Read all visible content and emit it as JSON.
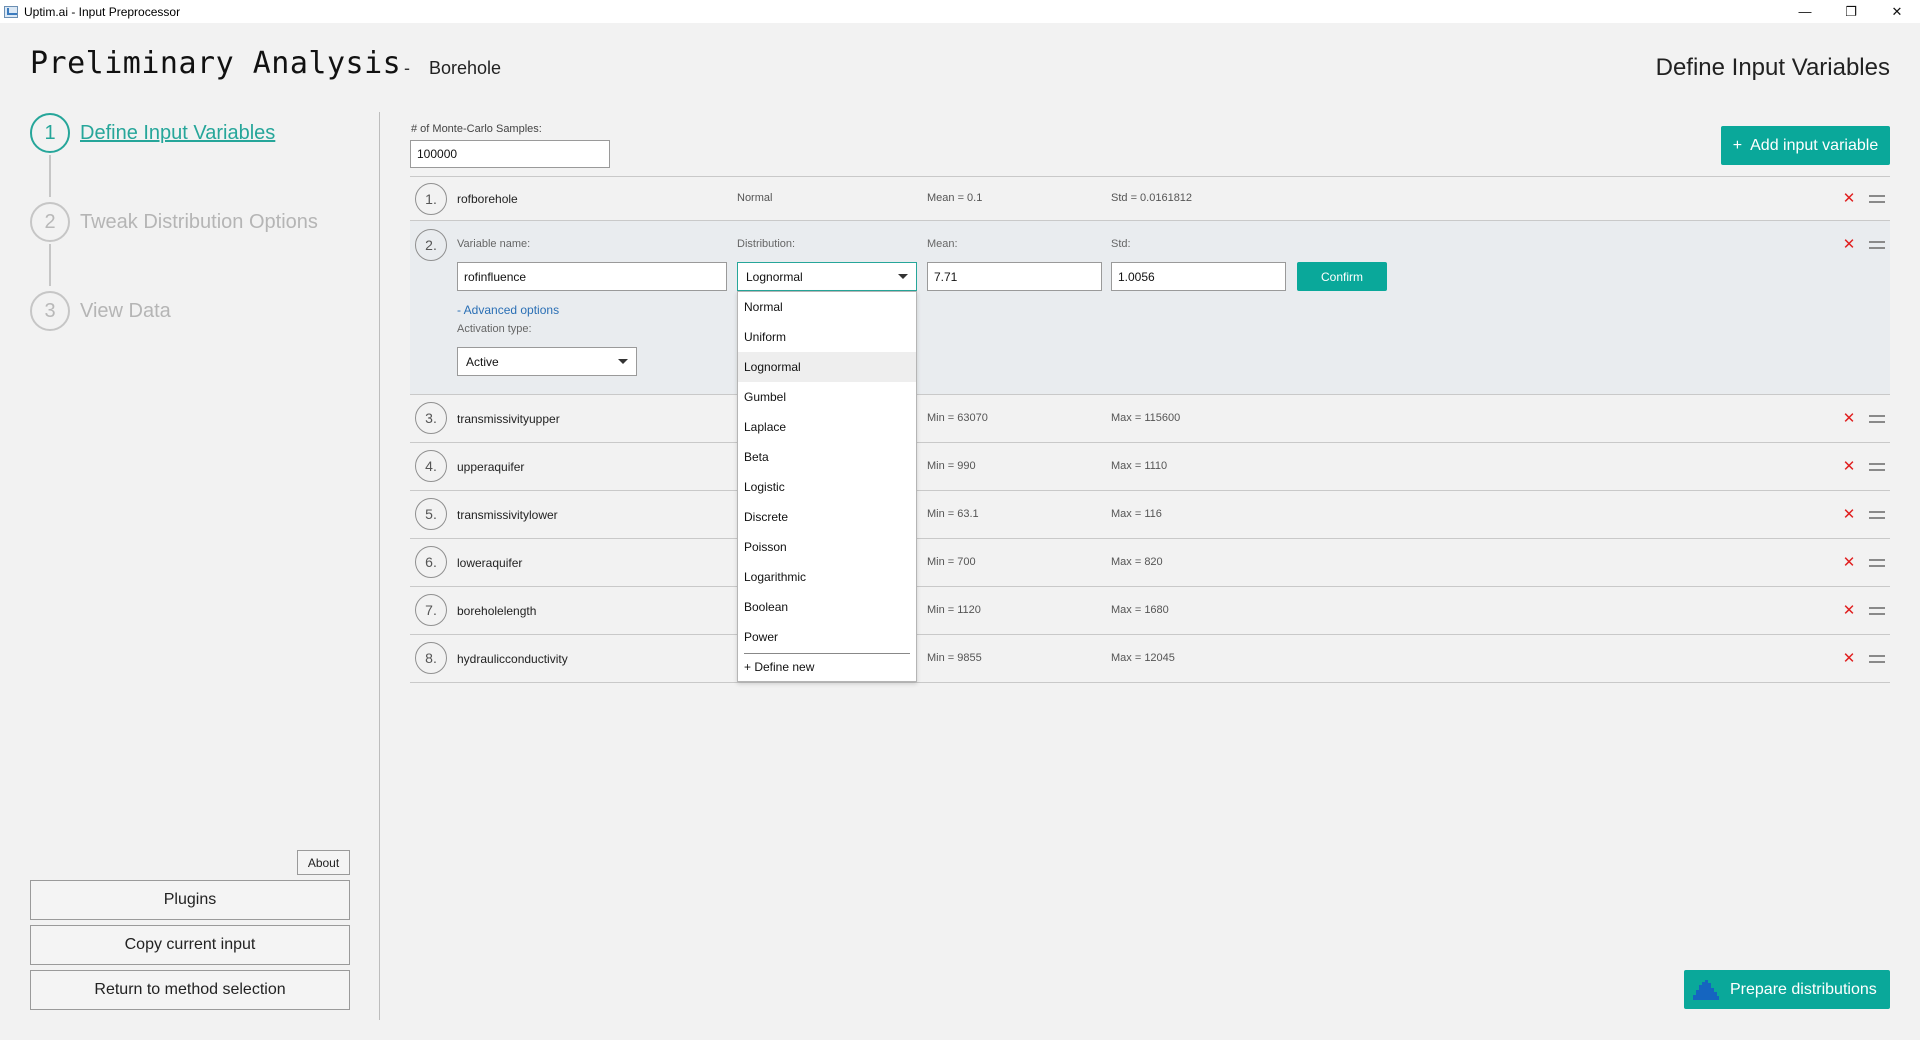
{
  "window": {
    "title": "Uptim.ai - Input Preprocessor",
    "minimize": "—",
    "restore": "❐",
    "close": "✕"
  },
  "header": {
    "title": "Preliminary Analysis",
    "separator": "-",
    "subtitle": "Borehole",
    "right_title": "Define Input Variables"
  },
  "steps": [
    {
      "number": "1",
      "label": "Define Input Variables",
      "active": true
    },
    {
      "number": "2",
      "label": "Tweak Distribution Options",
      "active": false
    },
    {
      "number": "3",
      "label": "View Data",
      "active": false
    }
  ],
  "left_buttons": {
    "about": "About",
    "plugins": "Plugins",
    "copy": "Copy current input",
    "return": "Return to method selection"
  },
  "monte_carlo": {
    "label": "# of Monte-Carlo Samples:",
    "value": "100000"
  },
  "add_button": {
    "icon": "+",
    "label": "Add input variable"
  },
  "rows": [
    {
      "num": "1.",
      "name": "rofborehole",
      "dist": "Normal",
      "p1": "Mean = 0.1",
      "p2": "Std = 0.0161812"
    },
    {
      "num": "3.",
      "name": "transmissivityupper",
      "dist": "",
      "p1": "Min = 63070",
      "p2": "Max = 115600"
    },
    {
      "num": "4.",
      "name": "upperaquifer",
      "dist": "",
      "p1": "Min = 990",
      "p2": "Max = 1110"
    },
    {
      "num": "5.",
      "name": "transmissivitylower",
      "dist": "",
      "p1": "Min = 63.1",
      "p2": "Max = 116"
    },
    {
      "num": "6.",
      "name": "loweraquifer",
      "dist": "",
      "p1": "Min = 700",
      "p2": "Max = 820"
    },
    {
      "num": "7.",
      "name": "boreholelength",
      "dist": "",
      "p1": "Min = 1120",
      "p2": "Max = 1680"
    },
    {
      "num": "8.",
      "name": "hydraulicconductivity",
      "dist": "",
      "p1": "Min = 9855",
      "p2": "Max = 12045"
    }
  ],
  "editor": {
    "num": "2.",
    "name_label": "Variable name:",
    "name_value": "rofinfluence",
    "dist_label": "Distribution:",
    "dist_value": "Lognormal",
    "mean_label": "Mean:",
    "mean_value": "7.71",
    "std_label": "Std:",
    "std_value": "1.0056",
    "confirm": "Confirm",
    "advanced": "- Advanced options",
    "activation_label": "Activation type:",
    "activation_value": "Active"
  },
  "dropdown": {
    "options": [
      "Normal",
      "Uniform",
      "Lognormal",
      "Gumbel",
      "Laplace",
      "Beta",
      "Logistic",
      "Discrete",
      "Poisson",
      "Logarithmic",
      "Boolean",
      "Power"
    ],
    "selected": "Lognormal",
    "define_new": "+ Define new"
  },
  "prepare_button": {
    "label": "Prepare distributions",
    "icon": "histogram-icon"
  },
  "colors": {
    "accent": "#0aa89a",
    "delete": "#e02020",
    "link": "#2a6fb5"
  },
  "icons": {
    "delete": "✕"
  }
}
